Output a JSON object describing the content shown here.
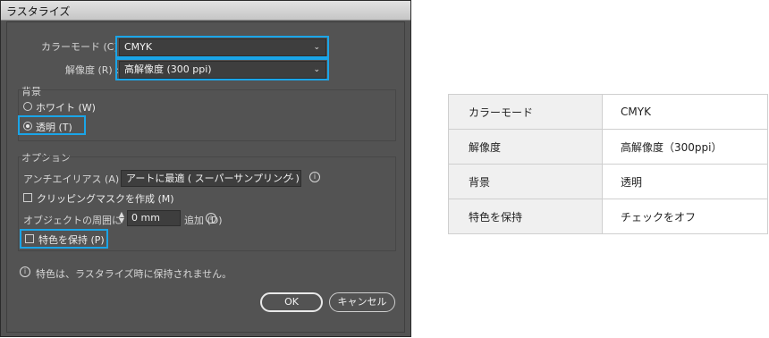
{
  "dialog": {
    "title": "ラスタライズ",
    "color_mode": {
      "label": "カラーモード (C) :",
      "value": "CMYK"
    },
    "resolution": {
      "label": "解像度 (R) :",
      "value": "高解像度 (300 ppi)"
    },
    "background": {
      "title": "背景",
      "white_label": "ホワイト (W)",
      "transparent_label": "透明 (T)",
      "selected": "transparent"
    },
    "options": {
      "title": "オプション",
      "antialias_label": "アンチエイリアス (A) :",
      "antialias_value": "アートに最適 ( スーパーサンプリング )",
      "clipping_mask_label": "クリッピングマスクを作成 (M)",
      "clipping_mask_checked": false,
      "padding_label": "オブジェクトの周囲に",
      "padding_value": "0 mm",
      "padding_suffix": "追加 (D)",
      "keep_spot_label": "特色を保持 (P)",
      "keep_spot_checked": false
    },
    "note": "特色は、ラスタライズ時に保持されません。",
    "ok_label": "OK",
    "cancel_label": "キャンセル"
  },
  "settings_table": [
    {
      "key": "カラーモード",
      "value": "CMYK"
    },
    {
      "key": "解像度",
      "value": "高解像度（300ppi）"
    },
    {
      "key": "背景",
      "value": "透明"
    },
    {
      "key": "特色を保持",
      "value": "チェックをオフ"
    }
  ],
  "colors": {
    "highlight": "#1aa5e8",
    "dialog_bg": "#535353",
    "field_bg": "#3e3e3e"
  }
}
